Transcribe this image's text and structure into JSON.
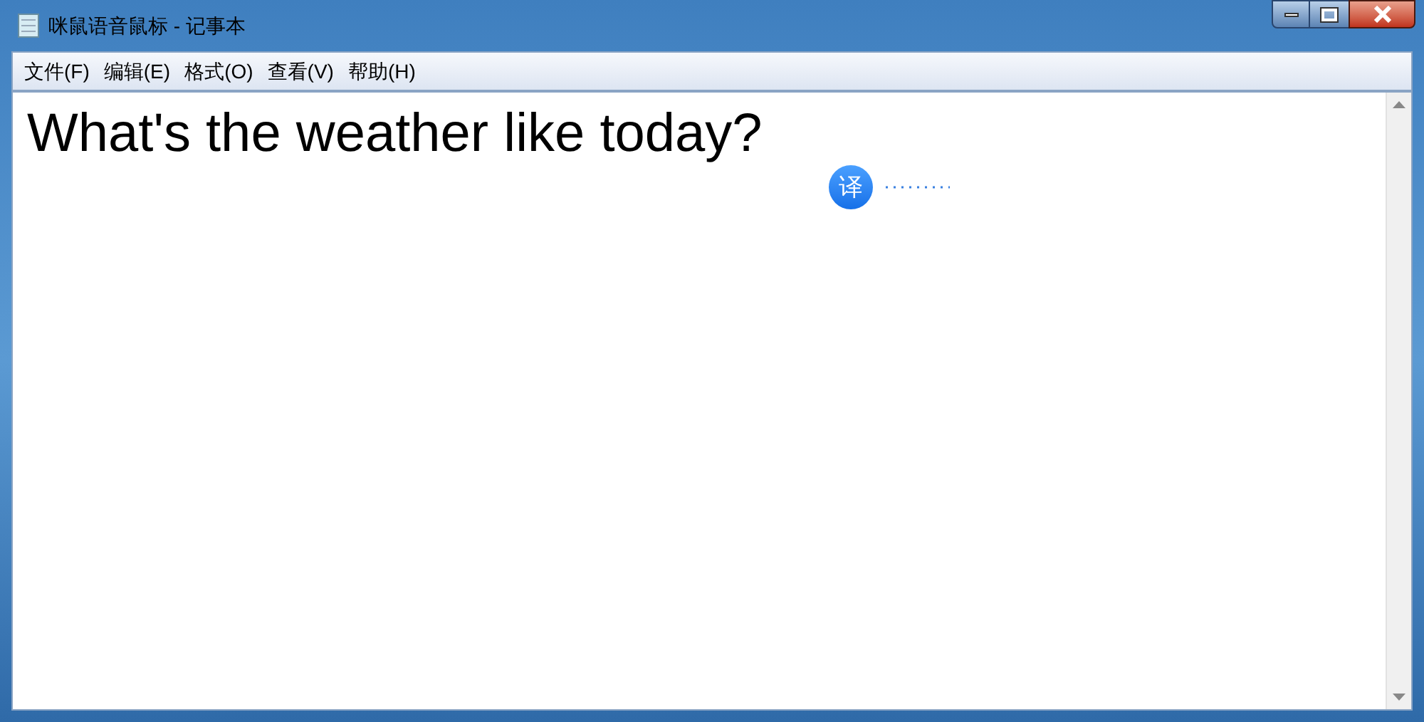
{
  "window": {
    "title": "咪鼠语音鼠标 - 记事本"
  },
  "menu": [
    "文件(F)",
    "编辑(E)",
    "格式(O)",
    "查看(V)",
    "帮助(H)"
  ],
  "editor": {
    "text": "What's the weather like today?"
  },
  "translate_button": {
    "label": "译"
  }
}
